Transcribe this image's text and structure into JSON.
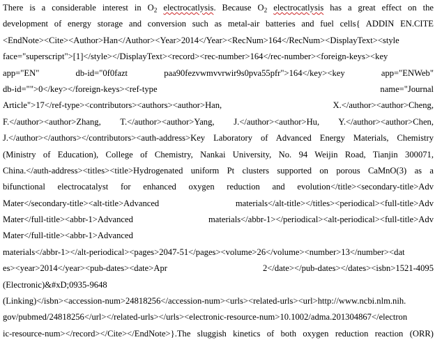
{
  "document": {
    "l1": {
      "a": "There is a considerable interest in O",
      "sub1": "2",
      "sp1": " ",
      "word1": "electrocatlysis",
      "b": ". Because O",
      "sub2": "2",
      "sp2": " ",
      "word2": "electrocatlysis",
      "c": " has a great effect on the"
    },
    "lines": [
      "development of energy storage and conversion such as metal-air batteries and fuel cells{ ADDIN EN.CITE",
      "<EndNote><Cite><Author>Han</Author><Year>2014</Year><RecNum>164</RecNum><DisplayText><style",
      "face=\"superscript\">[1]</style></DisplayText><record><rec-number>164</rec-number><foreign-keys><key",
      "app=\"EN\" db-id=\"0f0fazt paa90fezvwmvvrwir9s0pva55pfr\">164</key><key app=\"ENWeb\"",
      "db-id=\"\">0</key></foreign-keys><ref-type name=\"Journal",
      "Article\">17</ref-type><contributors><authors><author>Han, X.</author><author>Cheng,",
      "F.</author><author>Zhang, T.</author><author>Yang, J.</author><author>Hu, Y.</author><author>Chen,",
      "J.</author></authors></contributors><auth-address>Key Laboratory of Advanced Energy Materials, Chemistry",
      "(Ministry of Education), College of Chemistry, Nankai University, No. 94 Weijin Road, Tianjin 300071,",
      "China.</auth-address><titles><title>Hydrogenated uniform Pt clusters supported on porous CaMnO(3) as a",
      "bifunctional electrocatalyst for enhanced oxygen reduction and evolution</title><secondary-title>Adv",
      "Mater</secondary-title><alt-title>Advanced materials</alt-title></titles><periodical><full-title>Adv",
      "Mater</full-title><abbr-1>Advanced materials</abbr-1></periodical><alt-periodical><full-title>Adv",
      "Mater</full-title><abbr-1>Advanced",
      "materials</abbr-1></alt-periodical><pages>2047-51</pages><volume>26</volume><number>13</number><dat",
      "es><year>2014</year><pub-dates><date>Apr 2</date></pub-dates></dates><isbn>1521-4095",
      "(Electronic)&#xD;0935-9648",
      "(Linking)</isbn><accession-num>24818256</accession-num><urls><related-urls><url>http://www.ncbi.nlm.nih.",
      "gov/pubmed/24818256</url></related-urls></urls><electronic-resource-num>10.1002/adma.201304867</electron",
      "ic-resource-num></record></Cite></EndNote>}.The sluggish kinetics of both oxygen reduction reaction (ORR)"
    ]
  }
}
